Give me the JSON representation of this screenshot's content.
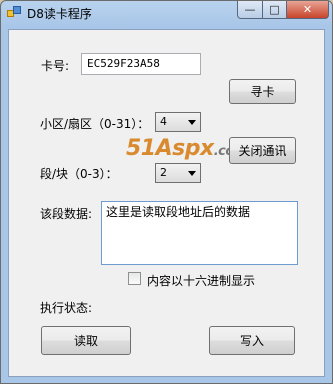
{
  "window": {
    "title": "D8读卡程序"
  },
  "controls": {
    "minimize": "—",
    "maximize": "□",
    "close": "✕"
  },
  "card": {
    "label": "卡号:",
    "value": "EC529F23A58",
    "find_button": "寻卡"
  },
  "sector": {
    "label": "小区/扇区（0-31）：",
    "selected": "4"
  },
  "close_comm_button": "关闭通讯",
  "watermark": {
    "main": "51Aspx",
    "suffix": ".com"
  },
  "block": {
    "label": "段/块（0-3）：",
    "selected": "2"
  },
  "data": {
    "label": "该段数据:",
    "value": "这里是读取段地址后的数据"
  },
  "hex_checkbox": {
    "label": "内容以十六进制显示",
    "checked": false
  },
  "status": {
    "label": "执行状态:"
  },
  "read_button": "读取",
  "write_button": "写入"
}
